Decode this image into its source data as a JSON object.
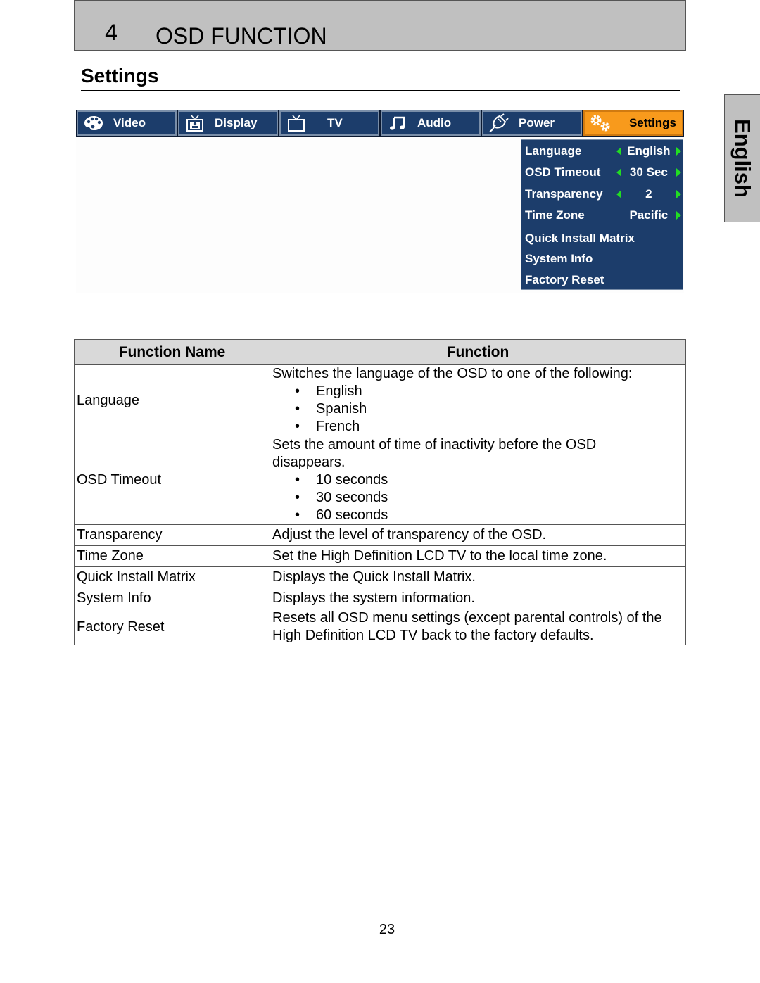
{
  "chapter": {
    "number": "4",
    "title": "OSD FUNCTION"
  },
  "section": {
    "title": "Settings"
  },
  "side_tab": {
    "label": "English"
  },
  "osd": {
    "tabs": [
      {
        "label": "Video",
        "icon": "palette-icon",
        "active": false
      },
      {
        "label": "Display",
        "icon": "display-tv-icon",
        "active": false
      },
      {
        "label": "TV",
        "icon": "tv-icon",
        "active": false
      },
      {
        "label": "Audio",
        "icon": "music-note-icon",
        "active": false
      },
      {
        "label": "Power",
        "icon": "power-plug-icon",
        "active": false
      },
      {
        "label": "Settings",
        "icon": "gears-icon",
        "active": true
      }
    ],
    "menu": [
      {
        "label": "Language",
        "value": "English",
        "left_arrow": true,
        "right_arrow": true
      },
      {
        "label": "OSD Timeout",
        "value": "30 Sec",
        "left_arrow": true,
        "right_arrow": true
      },
      {
        "label": "Transparency",
        "value": "2",
        "left_arrow": true,
        "right_arrow": true
      },
      {
        "label": "Time Zone",
        "value": "Pacific",
        "left_arrow": false,
        "right_arrow": true
      },
      {
        "label": "Quick Install Matrix"
      },
      {
        "label": "System Info"
      },
      {
        "label": "Factory Reset"
      }
    ],
    "colors": {
      "menu_bg": "#1c3d6b",
      "active_tab": "#f89a1c",
      "arrow": "#22dd22"
    }
  },
  "table": {
    "headers": [
      "Function Name",
      "Function"
    ],
    "rows": [
      {
        "name": "Language",
        "desc_lines": [
          "Switches the language of the OSD to one of the following:"
        ],
        "bullets": [
          "English",
          "Spanish",
          "French"
        ]
      },
      {
        "name": "OSD Timeout",
        "desc_lines": [
          "Sets the amount of time of inactivity before the OSD",
          "disappears."
        ],
        "bullets": [
          "10 seconds",
          "30 seconds",
          "60 seconds"
        ]
      },
      {
        "name": "Transparency",
        "desc_lines": [
          "Adjust the level of transparency of the OSD."
        ]
      },
      {
        "name": "Time Zone",
        "desc_lines": [
          "Set the High Definition LCD TV to the local time zone."
        ]
      },
      {
        "name": "Quick Install Matrix",
        "desc_lines": [
          "Displays the Quick Install Matrix."
        ]
      },
      {
        "name": "System Info",
        "desc_lines": [
          "Displays the system information."
        ]
      },
      {
        "name": "Factory Reset",
        "desc_lines": [
          "Resets all OSD menu settings (except parental controls) of the",
          "High Definition LCD TV back to the factory defaults."
        ]
      }
    ]
  },
  "page_number": "23"
}
